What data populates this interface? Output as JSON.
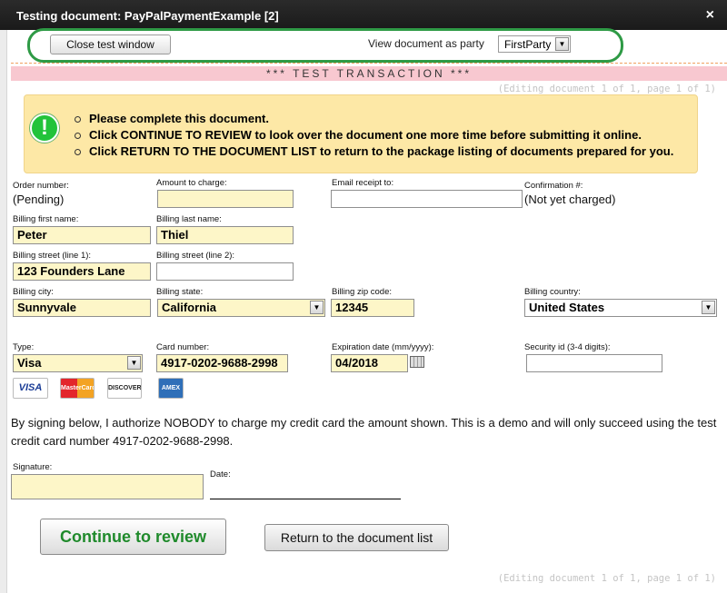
{
  "window": {
    "title": "Testing document: PayPalPaymentExample [2]",
    "close_glyph": "×"
  },
  "toolbar": {
    "close_button": "Close test window",
    "view_as_label": "View document as party",
    "party_selected": "FirstParty"
  },
  "banner": {
    "test_transaction": "*** TEST TRANSACTION ***",
    "editing_note": "(Editing document 1 of 1, page 1 of 1)"
  },
  "instructions": {
    "icon": "exclamation-icon",
    "items": [
      "Please complete this document.",
      "Click CONTINUE TO REVIEW to look over the document one more time before submitting it online.",
      "Click RETURN TO THE DOCUMENT LIST to return to the package listing of documents prepared for you."
    ]
  },
  "form": {
    "order_number": {
      "label": "Order number:",
      "value": "(Pending)"
    },
    "amount": {
      "label": "Amount to charge:",
      "value": ""
    },
    "email_receipt": {
      "label": "Email receipt to:",
      "value": ""
    },
    "confirmation": {
      "label": "Confirmation #:",
      "value": "(Not yet charged)"
    },
    "first_name": {
      "label": "Billing first name:",
      "value": "Peter"
    },
    "last_name": {
      "label": "Billing last name:",
      "value": "Thiel"
    },
    "street1": {
      "label": "Billing street (line 1):",
      "value": "123 Founders Lane"
    },
    "street2": {
      "label": "Billing street (line 2):",
      "value": ""
    },
    "city": {
      "label": "Billing city:",
      "value": "Sunnyvale"
    },
    "state": {
      "label": "Billing state:",
      "value": "California"
    },
    "zip": {
      "label": "Billing zip code:",
      "value": "12345"
    },
    "country": {
      "label": "Billing country:",
      "value": "United States"
    },
    "type": {
      "label": "Type:",
      "value": "Visa"
    },
    "card_number": {
      "label": "Card number:",
      "value": "4917-0202-9688-2998"
    },
    "expiration": {
      "label": "Expiration date (mm/yyyy):",
      "value": "04/2018"
    },
    "security_id": {
      "label": "Security id (3-4 digits):",
      "value": ""
    },
    "card_logos": [
      "VISA",
      "MasterCard",
      "DISCOVER",
      "AMEX"
    ],
    "authorization_text": "By signing below, I authorize NOBODY to charge my credit card the amount shown. This is a demo and will only succeed using the test credit card number 4917-0202-9688-2998.",
    "signature_label": "Signature:",
    "date_label": "Date:"
  },
  "actions": {
    "continue": "Continue to review",
    "return": "Return to the document list"
  },
  "colors": {
    "accent_green": "#1f8a2b",
    "highlight_ring": "#2e9a45",
    "info_bg": "#fde8a6",
    "field_bg": "#fdf6c8",
    "test_banner": "#f8c8d0"
  }
}
